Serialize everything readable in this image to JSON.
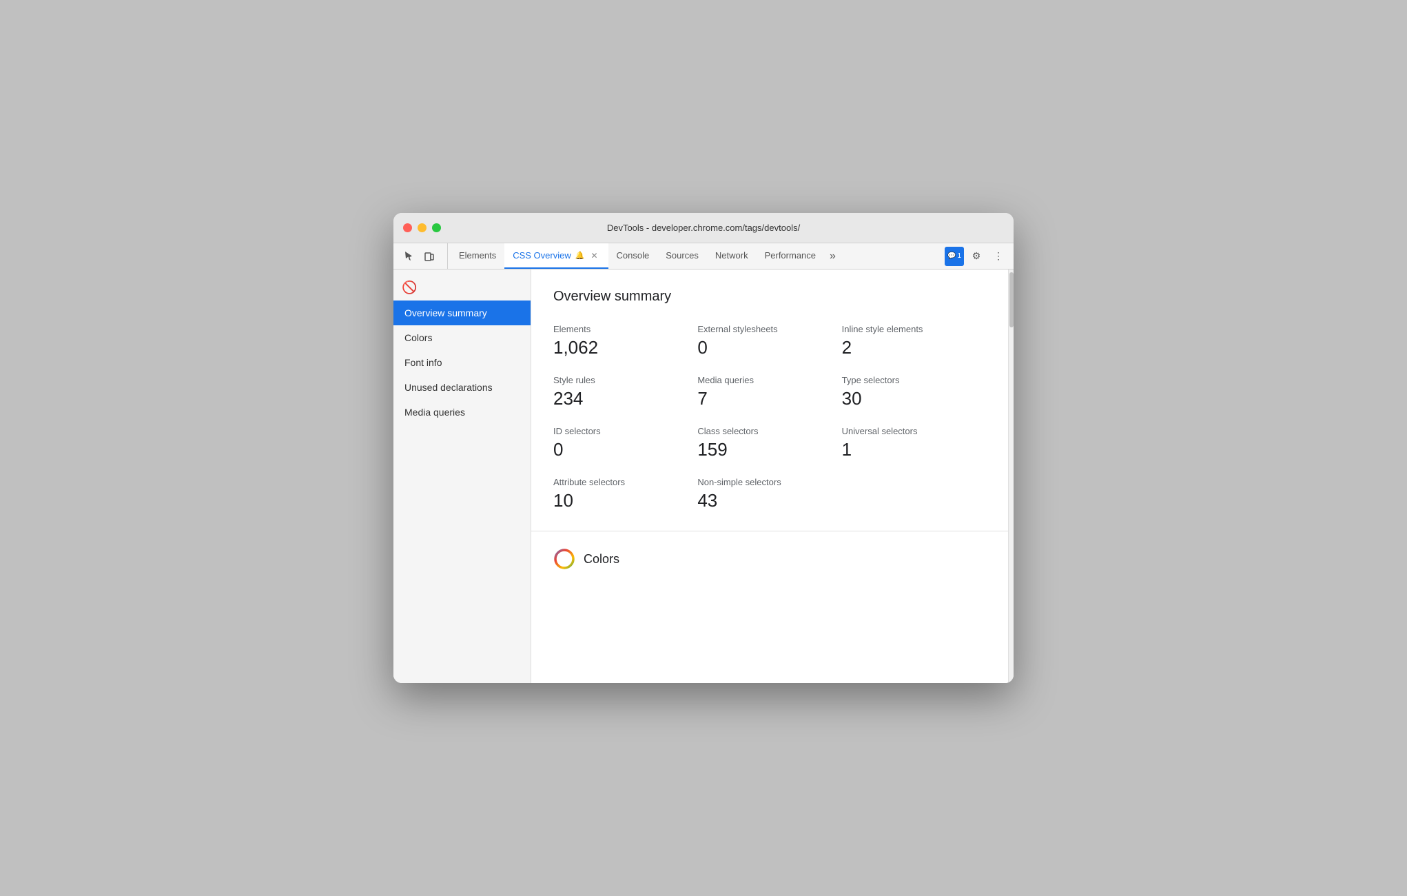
{
  "window": {
    "title": "DevTools - developer.chrome.com/tags/devtools/"
  },
  "tabs": [
    {
      "id": "elements",
      "label": "Elements",
      "active": false
    },
    {
      "id": "css-overview",
      "label": "CSS Overview",
      "active": true,
      "has_bell": true,
      "closable": true
    },
    {
      "id": "console",
      "label": "Console",
      "active": false
    },
    {
      "id": "sources",
      "label": "Sources",
      "active": false
    },
    {
      "id": "network",
      "label": "Network",
      "active": false
    },
    {
      "id": "performance",
      "label": "Performance",
      "active": false
    }
  ],
  "tabbar": {
    "more_label": "»",
    "notifications_count": "1",
    "settings_icon": "⚙",
    "more_icon": "⋮"
  },
  "sidebar": {
    "items": [
      {
        "id": "overview-summary",
        "label": "Overview summary",
        "active": true
      },
      {
        "id": "colors",
        "label": "Colors",
        "active": false
      },
      {
        "id": "font-info",
        "label": "Font info",
        "active": false
      },
      {
        "id": "unused-declarations",
        "label": "Unused declarations",
        "active": false
      },
      {
        "id": "media-queries",
        "label": "Media queries",
        "active": false
      }
    ]
  },
  "overview": {
    "title": "Overview summary",
    "stats": [
      {
        "label": "Elements",
        "value": "1,062"
      },
      {
        "label": "External stylesheets",
        "value": "0"
      },
      {
        "label": "Inline style elements",
        "value": "2"
      },
      {
        "label": "Style rules",
        "value": "234"
      },
      {
        "label": "Media queries",
        "value": "7"
      },
      {
        "label": "Type selectors",
        "value": "30"
      },
      {
        "label": "ID selectors",
        "value": "0"
      },
      {
        "label": "Class selectors",
        "value": "159"
      },
      {
        "label": "Universal selectors",
        "value": "1"
      },
      {
        "label": "Attribute selectors",
        "value": "10"
      },
      {
        "label": "Non-simple selectors",
        "value": "43"
      }
    ]
  },
  "colors_section": {
    "label": "Colors"
  }
}
